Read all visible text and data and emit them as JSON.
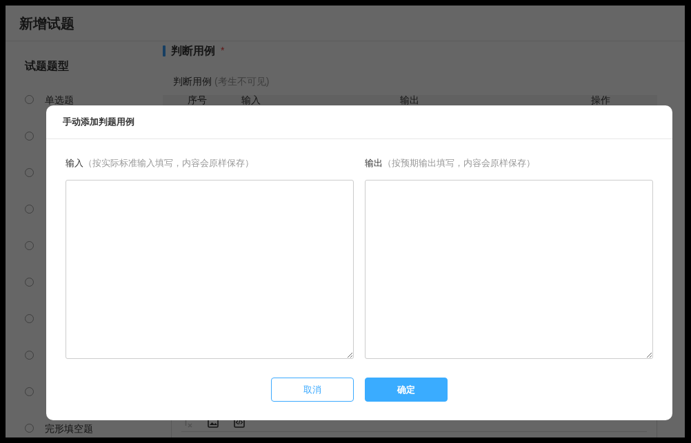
{
  "page": {
    "title": "新增试题"
  },
  "sidebar": {
    "title": "试题题型",
    "items": [
      {
        "label": "单选题",
        "selected": false
      },
      {
        "selected": false
      },
      {
        "selected": false
      },
      {
        "selected": false
      },
      {
        "selected": false
      },
      {
        "selected": false
      },
      {
        "selected": false
      },
      {
        "selected": false
      },
      {
        "selected": false
      },
      {
        "label": "完形填空题",
        "selected": false
      }
    ]
  },
  "section": {
    "title": "判断用例",
    "required_mark": "*",
    "subtitle": "判断用例",
    "subtitle_hint": "(考生不可见)",
    "table": {
      "columns": [
        "序号",
        "输入",
        "输出",
        "操作"
      ]
    }
  },
  "editor": {
    "toolbar": [
      {
        "kind": "clear",
        "disabled": true
      },
      {
        "kind": "image",
        "disabled": false
      },
      {
        "kind": "code",
        "disabled": false
      }
    ]
  },
  "dialog": {
    "title": "手动添加判题用例",
    "fields": [
      {
        "label": "输入",
        "hint": "（按实际标准输入填写，内容会原样保存）"
      },
      {
        "label": "输出",
        "hint": "（按预期输出填写，内容会原样保存）"
      }
    ],
    "buttons": [
      {
        "label": "取消",
        "kind": "secondary"
      },
      {
        "label": "确定",
        "kind": "primary"
      }
    ]
  }
}
